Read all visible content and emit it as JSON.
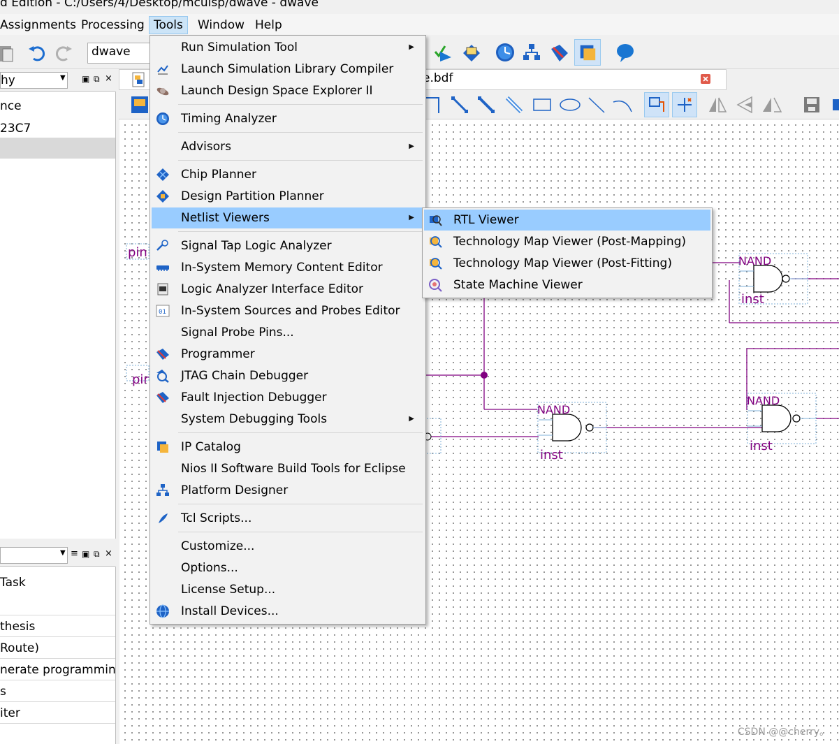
{
  "window": {
    "title": "d Edition - C:/Users/4/Desktop/mcuisp/dwave - dwave"
  },
  "menubar": [
    "Assignments",
    "Processing",
    "Tools",
    "Window",
    "Help"
  ],
  "toolbar": {
    "project": "dwave"
  },
  "hierarchy_pane": {
    "title": "hy",
    "rows": [
      "nce",
      "23C7",
      ""
    ]
  },
  "tasks_pane": {
    "title": "",
    "rows": [
      "Task",
      "",
      "thesis",
      "Route)",
      "nerate programming",
      "s",
      "iter"
    ]
  },
  "document": {
    "tab_label": "e.bdf"
  },
  "schematic": {
    "pin_labels": [
      "pin",
      "pir"
    ],
    "gates": [
      {
        "type": "NAND",
        "inst": "inst"
      },
      {
        "type": "NAND",
        "inst": "inst"
      },
      {
        "type": "NAND",
        "inst": "inst"
      }
    ]
  },
  "tools_menu": {
    "items": [
      {
        "label": "Run Simulation Tool",
        "icon": "none",
        "submenu": true
      },
      {
        "label": "Launch Simulation Library Compiler",
        "icon": "sim-library-icon"
      },
      {
        "label": "Launch Design Space Explorer II",
        "icon": "dse-icon"
      },
      {
        "label": "Timing Analyzer",
        "icon": "timing-clock-icon"
      },
      {
        "label": "Advisors",
        "icon": "none",
        "submenu": true
      },
      {
        "label": "Chip Planner",
        "icon": "chip-planner-icon"
      },
      {
        "label": "Design Partition Planner",
        "icon": "partition-planner-icon"
      },
      {
        "label": "Netlist Viewers",
        "icon": "none",
        "submenu": true,
        "highlighted": true
      },
      {
        "label": "Signal Tap Logic Analyzer",
        "icon": "signal-tap-icon"
      },
      {
        "label": "In-System Memory Content Editor",
        "icon": "memory-editor-icon"
      },
      {
        "label": "Logic Analyzer Interface Editor",
        "icon": "logic-analyzer-icon"
      },
      {
        "label": "In-System Sources and Probes Editor",
        "icon": "sources-probes-icon"
      },
      {
        "label": "Signal Probe Pins...",
        "icon": "none"
      },
      {
        "label": "Programmer",
        "icon": "programmer-icon"
      },
      {
        "label": "JTAG Chain Debugger",
        "icon": "jtag-icon"
      },
      {
        "label": "Fault Injection Debugger",
        "icon": "fault-injection-icon"
      },
      {
        "label": "System Debugging Tools",
        "icon": "none",
        "submenu": true
      },
      {
        "label": "IP Catalog",
        "icon": "ip-catalog-icon"
      },
      {
        "label": "Nios II Software Build Tools for Eclipse",
        "icon": "none"
      },
      {
        "label": "Platform Designer",
        "icon": "platform-designer-icon"
      },
      {
        "label": "Tcl Scripts...",
        "icon": "tcl-feather-icon"
      },
      {
        "label": "Customize...",
        "icon": "none"
      },
      {
        "label": "Options...",
        "icon": "none"
      },
      {
        "label": "License Setup...",
        "icon": "none"
      },
      {
        "label": "Install Devices...",
        "icon": "install-globe-icon"
      }
    ]
  },
  "netlist_submenu": {
    "items": [
      {
        "label": "RTL Viewer",
        "icon": "rtl-viewer-icon",
        "highlighted": true
      },
      {
        "label": "Technology Map Viewer (Post-Mapping)",
        "icon": "techmap-icon"
      },
      {
        "label": "Technology Map Viewer (Post-Fitting)",
        "icon": "techmap-icon"
      },
      {
        "label": "State Machine Viewer",
        "icon": "state-machine-icon"
      }
    ]
  },
  "watermark": "CSDN @@cherry。"
}
